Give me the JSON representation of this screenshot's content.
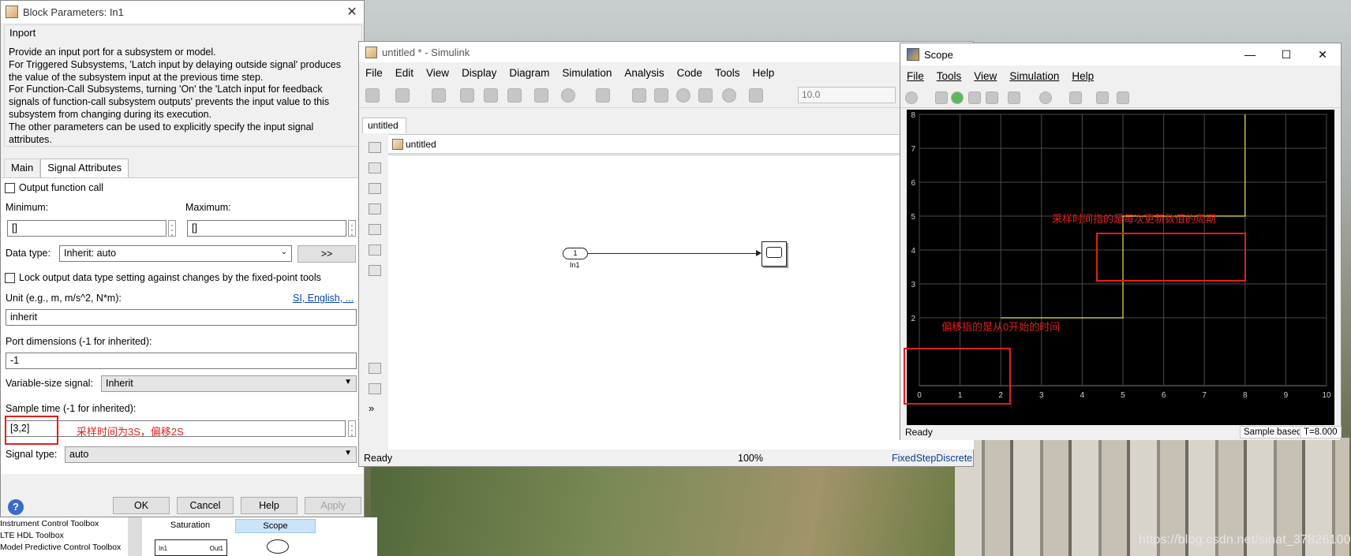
{
  "desktop": {
    "watermark": "https://blog.csdn.net/sinat_37826100"
  },
  "dialog": {
    "title": "Block Parameters: In1",
    "group_label": "Inport",
    "description": [
      "Provide an input port for a subsystem or model.",
      "For Triggered Subsystems, 'Latch input by delaying outside signal' produces",
      "the value of the subsystem input at the previous time step.",
      "For Function-Call Subsystems, turning 'On' the 'Latch input for feedback",
      "signals of function-call subsystem outputs' prevents the input value to this",
      "subsystem from changing during its execution.",
      "The other parameters can be used to explicitly specify the input signal",
      "attributes."
    ],
    "tabs": [
      "Main",
      "Signal Attributes"
    ],
    "active_tab": "Signal Attributes",
    "output_function_call": "Output function call",
    "minimum_label": "Minimum:",
    "minimum_value": "[]",
    "maximum_label": "Maximum:",
    "maximum_value": "[]",
    "data_type_label": "Data type:",
    "data_type_value": "Inherit: auto",
    "data_type_button": ">>",
    "lock_label": "Lock output data type setting against changes by the fixed-point tools",
    "unit_label": "Unit (e.g., m, m/s^2, N*m):",
    "unit_link": "SI, English, ...",
    "unit_value": "inherit",
    "port_dim_label": "Port dimensions (-1 for inherited):",
    "port_dim_value": "-1",
    "varsize_label": "Variable-size signal:",
    "varsize_value": "Inherit",
    "sample_time_label": "Sample time (-1 for inherited):",
    "sample_time_value": "[3,2]",
    "sample_time_annotation": "采样时间为3S，偏移2S",
    "signal_type_label": "Signal type:",
    "signal_type_value": "auto",
    "buttons": {
      "ok": "OK",
      "cancel": "Cancel",
      "help": "Help",
      "apply": "Apply"
    },
    "help_icon": "?"
  },
  "library": {
    "items": [
      "Instrument Control Toolbox",
      "LTE HDL Toolbox",
      "Model Predictive Control Toolbox"
    ],
    "categories": [
      "Saturation",
      "Scope"
    ],
    "block_in": "In1",
    "block_out": "Out1"
  },
  "simulink": {
    "title": "untitled * - Simulink",
    "menu": [
      "File",
      "Edit",
      "View",
      "Display",
      "Diagram",
      "Simulation",
      "Analysis",
      "Code",
      "Tools",
      "Help"
    ],
    "sim_time": "10.0",
    "model_tab": "untitled",
    "breadcrumb": "untitled",
    "inport_number": "1",
    "inport_label": "In1",
    "status": "Ready",
    "zoom": "100%",
    "solver": "FixedStepDiscrete"
  },
  "scope": {
    "title": "Scope",
    "menu": [
      "File",
      "Tools",
      "View",
      "Simulation",
      "Help"
    ],
    "annotation_sample": "采样时间指的是每次更新数值的周期",
    "annotation_offset": "偏移指的是从0开始的时间",
    "status": "Ready",
    "sample_based": "Sample based",
    "time_readout": "T=8.000"
  },
  "chart_data": {
    "type": "line",
    "style": "step",
    "xlim": [
      0,
      10
    ],
    "ylim": [
      0,
      8
    ],
    "xticks": [
      0,
      1,
      2,
      3,
      4,
      5,
      6,
      7,
      8,
      9,
      10
    ],
    "yticks": [
      2,
      3,
      4,
      5,
      6,
      7,
      8
    ],
    "grid": true,
    "series": [
      {
        "color": "#e8e84a",
        "x": [
          2,
          5,
          5,
          8,
          8
        ],
        "y": [
          2,
          2,
          5,
          5,
          8
        ]
      }
    ]
  },
  "colors": {
    "annotation": "#e0201d",
    "trace": "#e8e84a",
    "link": "#0645ad"
  }
}
